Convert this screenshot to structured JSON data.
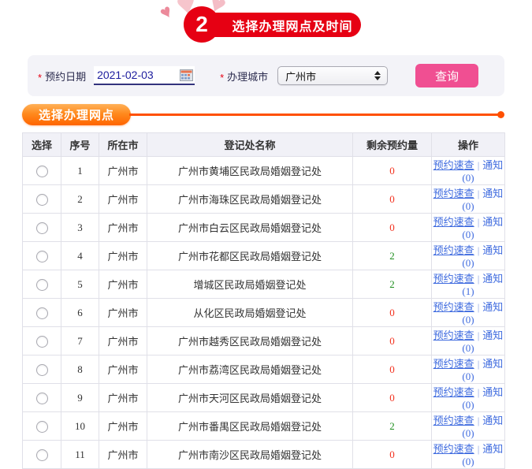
{
  "header": {
    "step_number": "2",
    "title": "选择办理网点及时间"
  },
  "form": {
    "required_mark": "*",
    "date_label": "预约日期",
    "date_value": "2021-02-03",
    "city_label": "办理城市",
    "city_value": "广州市",
    "query_button": "查询"
  },
  "section": {
    "title": "选择办理网点"
  },
  "table": {
    "columns": [
      "选择",
      "序号",
      "所在市",
      "登记处名称",
      "剩余预约量",
      "操作"
    ],
    "rows": [
      {
        "no": "1",
        "city": "广州市",
        "name": "广州市黄埔区民政局婚姻登记处",
        "remaining": "0",
        "remaining_color": "#f3311e",
        "check": "预约速查",
        "separator": "|",
        "notice": "通知(0)"
      },
      {
        "no": "2",
        "city": "广州市",
        "name": "广州市海珠区民政局婚姻登记处",
        "remaining": "0",
        "remaining_color": "#f3311e",
        "check": "预约速查",
        "separator": "|",
        "notice": "通知(0)"
      },
      {
        "no": "3",
        "city": "广州市",
        "name": "广州市白云区民政局婚姻登记处",
        "remaining": "0",
        "remaining_color": "#f3311e",
        "check": "预约速查",
        "separator": "|",
        "notice": "通知(0)"
      },
      {
        "no": "4",
        "city": "广州市",
        "name": "广州市花都区民政局婚姻登记处",
        "remaining": "2",
        "remaining_color": "#1f8f1f",
        "check": "预约速查",
        "separator": "|",
        "notice": "通知(0)"
      },
      {
        "no": "5",
        "city": "广州市",
        "name": "增城区民政局婚姻登记处",
        "remaining": "2",
        "remaining_color": "#1f8f1f",
        "check": "预约速查",
        "separator": "|",
        "notice": "通知(1)"
      },
      {
        "no": "6",
        "city": "广州市",
        "name": "从化区民政局婚姻登记处",
        "remaining": "0",
        "remaining_color": "#f3311e",
        "check": "预约速查",
        "separator": "|",
        "notice": "通知(0)"
      },
      {
        "no": "7",
        "city": "广州市",
        "name": "广州市越秀区民政局婚姻登记处",
        "remaining": "0",
        "remaining_color": "#f3311e",
        "check": "预约速查",
        "separator": "|",
        "notice": "通知(0)"
      },
      {
        "no": "8",
        "city": "广州市",
        "name": "广州市荔湾区民政局婚姻登记处",
        "remaining": "0",
        "remaining_color": "#f3311e",
        "check": "预约速查",
        "separator": "|",
        "notice": "通知(0)"
      },
      {
        "no": "9",
        "city": "广州市",
        "name": "广州市天河区民政局婚姻登记处",
        "remaining": "0",
        "remaining_color": "#f3311e",
        "check": "预约速查",
        "separator": "|",
        "notice": "通知(0)"
      },
      {
        "no": "10",
        "city": "广州市",
        "name": "广州市番禺区民政局婚姻登记处",
        "remaining": "2",
        "remaining_color": "#1f8f1f",
        "check": "预约速查",
        "separator": "|",
        "notice": "通知(0)"
      },
      {
        "no": "11",
        "city": "广州市",
        "name": "广州市南沙区民政局婚姻登记处",
        "remaining": "0",
        "remaining_color": "#f3311e",
        "check": "预约速查",
        "separator": "|",
        "notice": "通知(0)"
      }
    ]
  },
  "colors": {
    "brand_red": "#e60013",
    "button_pink": "#f04f92",
    "section_orange": "#ff6400",
    "divider_orange": "#ff5000",
    "link_blue": "#3f6bdf",
    "remaining_zero": "#f3311e",
    "remaining_available": "#1f8f1f",
    "date_text": "#1d1d9e"
  }
}
